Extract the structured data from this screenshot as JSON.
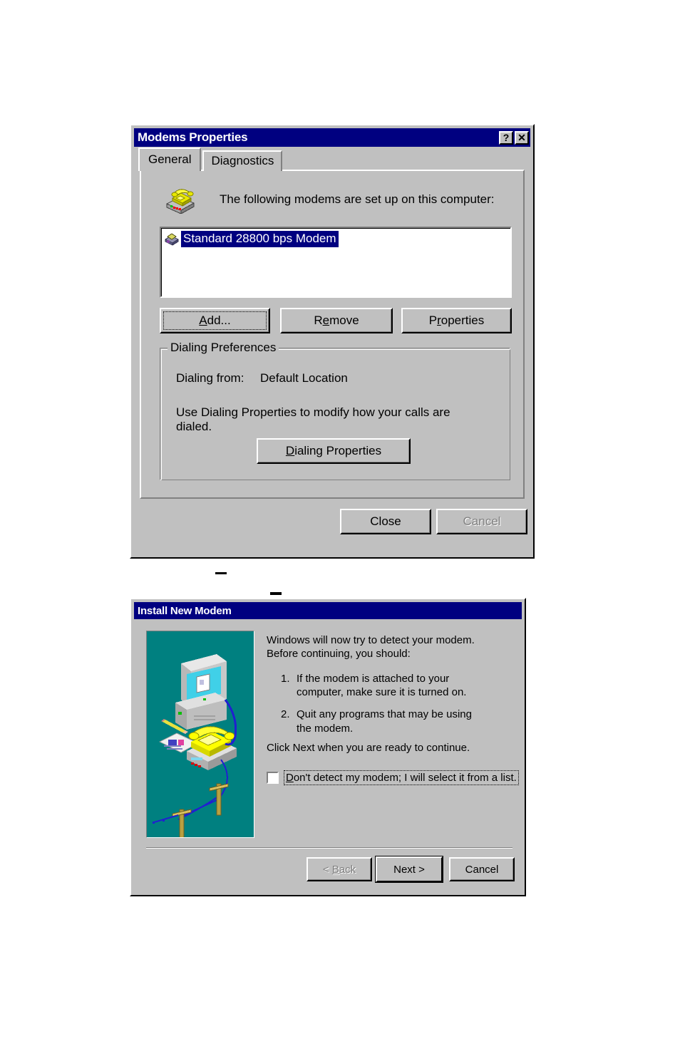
{
  "page": {
    "background_color": "#ffffff",
    "dialog_face_color": "#c0c0c0",
    "titlebar_color": "#000080",
    "wizard_art_color": "#008080",
    "selection_color": "#000080"
  },
  "modems_properties_dialog": {
    "title": "Modems Properties",
    "title_buttons": [
      {
        "name": "help-button",
        "glyph": "?"
      },
      {
        "name": "close-button",
        "glyph": "✕"
      }
    ],
    "tabs": [
      {
        "label": "General",
        "active": true
      },
      {
        "label": "Diagnostics",
        "active": false
      }
    ],
    "intro_text": "The following modems are set up on this computer:",
    "modem_icon_name": "modem-phone-icon",
    "modem_list": [
      {
        "label": "Standard 28800 bps Modem",
        "selected": true,
        "icon": "modem-device-icon"
      }
    ],
    "action_buttons": [
      {
        "label": "Add...",
        "accel": "A",
        "focused": true,
        "disabled": false
      },
      {
        "label": "Remove",
        "accel": "e",
        "focused": false,
        "disabled": false
      },
      {
        "label": "Properties",
        "accel": "r",
        "focused": false,
        "disabled": false
      }
    ],
    "dialing_preferences": {
      "group_title": "Dialing Preferences",
      "dialing_from_label": "Dialing from:",
      "dialing_from_value": "Default Location",
      "hint_text": "Use Dialing Properties to modify how your calls are dialed.",
      "button_label": "Dialing Properties",
      "button_accel": "D"
    },
    "footer_buttons": [
      {
        "label": "Close",
        "disabled": false
      },
      {
        "label": "Cancel",
        "disabled": true
      }
    ]
  },
  "install_new_modem_dialog": {
    "title": "Install New Modem",
    "art_name": "computer-and-modem-illustration",
    "intro_text": "Windows will now try to detect your modem.  Before continuing, you should:",
    "steps": [
      {
        "num": "1.",
        "text": "If the modem is attached to your computer, make sure it is turned on."
      },
      {
        "num": "2.",
        "text": "Quit any programs that may be using the modem."
      }
    ],
    "continue_text": "Click Next when you are ready to continue.",
    "checkbox": {
      "label": "Don't detect my modem; I will select it from a list.",
      "accel": "D",
      "checked": false
    },
    "footer_buttons": [
      {
        "label": "< Back",
        "accel": "B",
        "disabled": true,
        "default": false
      },
      {
        "label": "Next >",
        "disabled": false,
        "default": true
      },
      {
        "label": "Cancel",
        "disabled": false,
        "default": false
      }
    ]
  }
}
